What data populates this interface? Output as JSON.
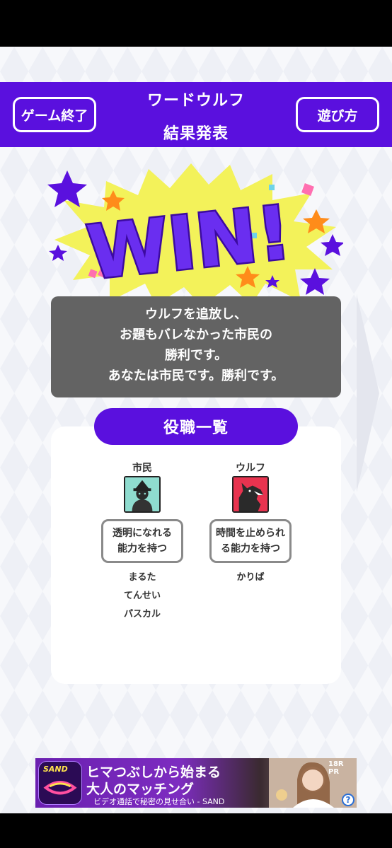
{
  "header": {
    "left_button": "ゲーム終了",
    "right_button": "遊び方",
    "title_line1": "ワードウルフ",
    "title_line2": "結果発表"
  },
  "banner": {
    "text": "WIN!"
  },
  "result": {
    "lines": [
      "ウルフを追放し、",
      "お題もバレなかった市民の",
      "勝利です。",
      "あなたは市民です。勝利です。"
    ]
  },
  "roles": {
    "title": "役職一覧",
    "items": [
      {
        "name": "市民",
        "icon": "citizen-icon",
        "ability_l1": "透明になれる",
        "ability_l2": "能力を持つ",
        "players": [
          "まるた",
          "てんせい",
          "パスカル"
        ]
      },
      {
        "name": "ウルフ",
        "icon": "wolf-icon",
        "ability_l1": "時間を止められ",
        "ability_l2": "る能力を持つ",
        "players": [
          "かりば"
        ]
      }
    ]
  },
  "ad": {
    "logo": "SAND",
    "line1": "ヒマつぶしから始まる",
    "line2": "大人のマッチング",
    "line3": "ビデオ通話で秘密の見せ合い - SAND",
    "badge": "18R PR",
    "help": "?"
  },
  "colors": {
    "accent": "#5a10de",
    "result_bg": "#636363"
  }
}
